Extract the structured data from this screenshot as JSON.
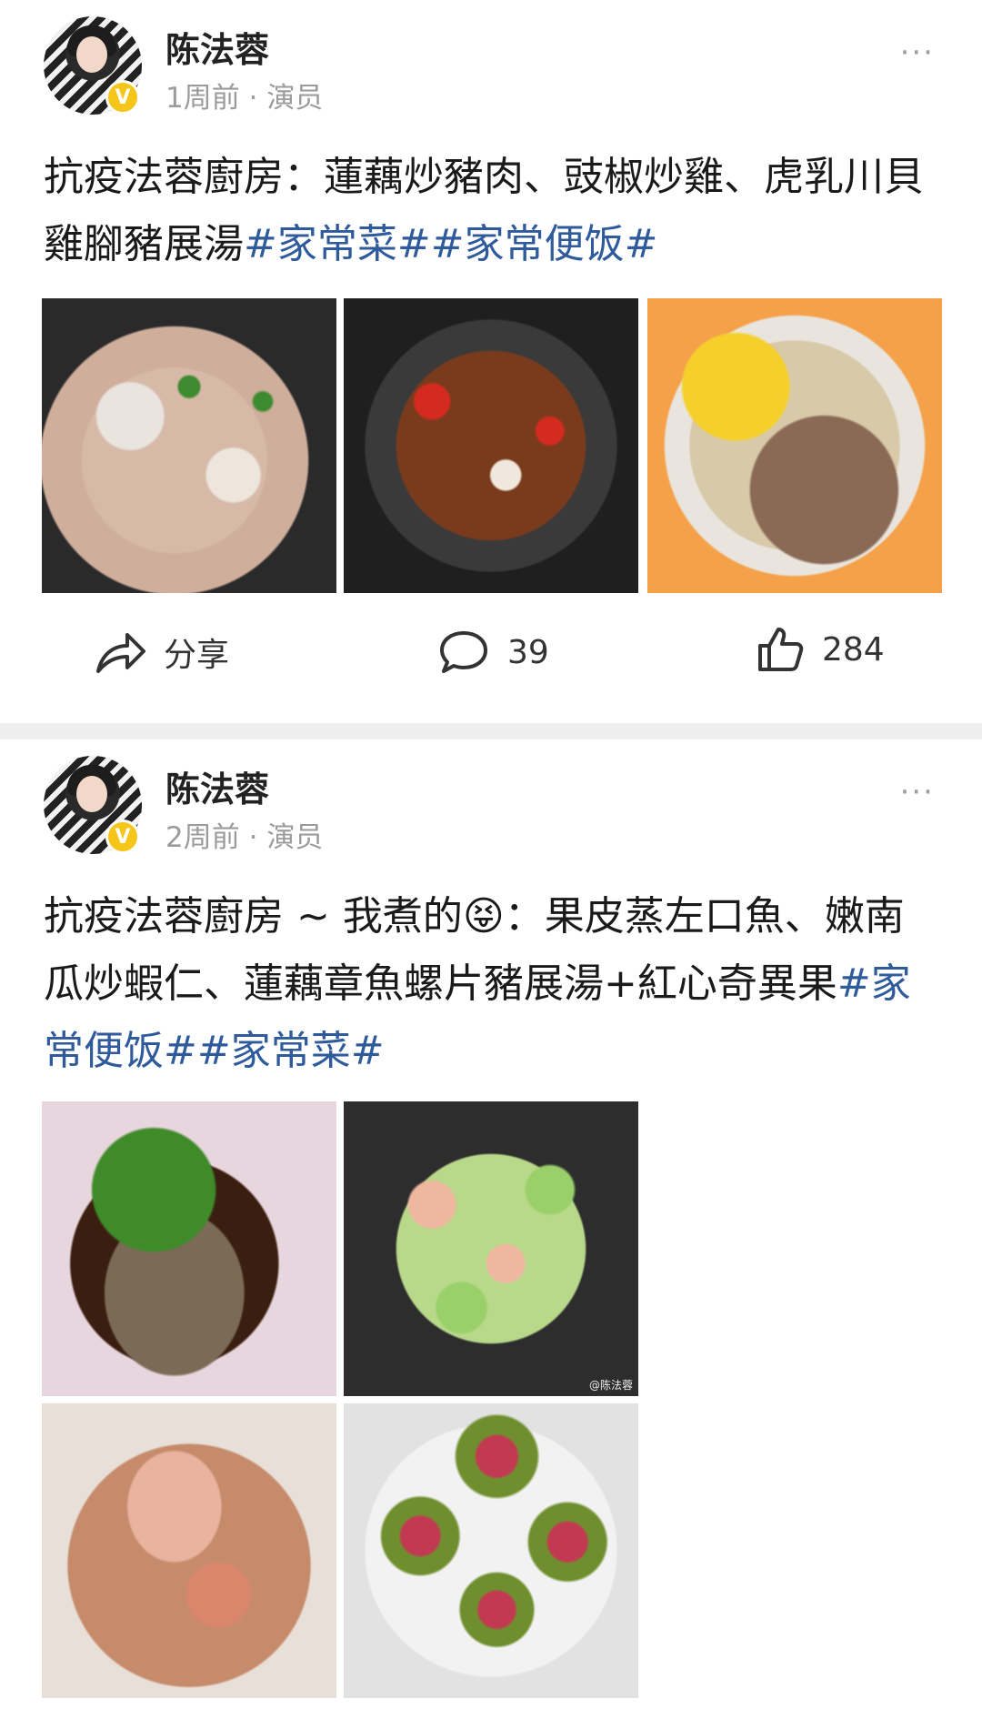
{
  "posts": [
    {
      "author": "陈法蓉",
      "time": "1周前",
      "separator": "·",
      "role": "演员",
      "more": "···",
      "text": "抗疫法蓉廚房：蓮藕炒豬肉、豉椒炒雞、虎乳川貝雞腳豬展湯",
      "tags": [
        "#家常菜#",
        "#家常便饭#"
      ],
      "actions": {
        "share_label": "分享",
        "comments": "39",
        "likes": "284"
      }
    },
    {
      "author": "陈法蓉",
      "time": "2周前",
      "separator": "·",
      "role": "演员",
      "more": "···",
      "text_before_emoji": "抗疫法蓉廚房 ~ 我煮的",
      "emoji": "😝",
      "text_after_emoji": "：果皮蒸左口魚、嫩南瓜炒蝦仁、蓮藕章魚螺片豬展湯+紅心奇異果",
      "tags": [
        "#家常便饭#",
        "#家常菜#"
      ],
      "watermark": "@陈法蓉"
    }
  ],
  "colors": {
    "tag": "#2f5a9b",
    "meta": "#9b9b9b",
    "badge": "#f5c518",
    "divider": "#eeeeee"
  },
  "icons": [
    "more-icon",
    "verified-badge-icon",
    "share-icon",
    "comment-icon",
    "like-icon"
  ]
}
